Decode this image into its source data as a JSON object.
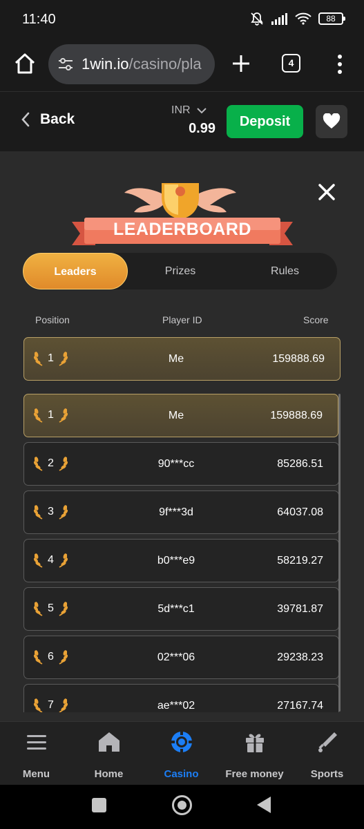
{
  "status_bar": {
    "time": "11:40",
    "battery": "88"
  },
  "browser": {
    "url_host": "1win.io",
    "url_path": "/casino/pla",
    "tab_count": "4"
  },
  "header": {
    "back_label": "Back",
    "currency": "INR",
    "balance": "0.99",
    "deposit_label": "Deposit"
  },
  "leaderboard": {
    "title": "LEADERBOARD",
    "tabs": [
      {
        "label": "Leaders",
        "active": true
      },
      {
        "label": "Prizes",
        "active": false
      },
      {
        "label": "Rules",
        "active": false
      }
    ],
    "columns": {
      "position": "Position",
      "player": "Player ID",
      "score": "Score"
    },
    "my_entry": {
      "position": "1",
      "player": "Me",
      "score": "159888.69"
    },
    "rows": [
      {
        "position": "1",
        "player": "Me",
        "score": "159888.69"
      },
      {
        "position": "2",
        "player": "90***cc",
        "score": "85286.51"
      },
      {
        "position": "3",
        "player": "9f***3d",
        "score": "64037.08"
      },
      {
        "position": "4",
        "player": "b0***e9",
        "score": "58219.27"
      },
      {
        "position": "5",
        "player": "5d***c1",
        "score": "39781.87"
      },
      {
        "position": "6",
        "player": "02***06",
        "score": "29238.23"
      },
      {
        "position": "7",
        "player": "ae***02",
        "score": "27167.74"
      }
    ]
  },
  "bottom_nav": [
    {
      "label": "Menu",
      "icon": "menu-icon",
      "active": false
    },
    {
      "label": "Home",
      "icon": "home-icon",
      "active": false
    },
    {
      "label": "Casino",
      "icon": "casino-chip-icon",
      "active": true
    },
    {
      "label": "Free money",
      "icon": "gift-icon",
      "active": false
    },
    {
      "label": "Sports",
      "icon": "sports-icon",
      "active": false
    }
  ],
  "colors": {
    "accent_gold": "#e9a236",
    "deposit_green": "#08b04a",
    "active_blue": "#1c7ef5",
    "my_row_bg": "#554a32"
  }
}
